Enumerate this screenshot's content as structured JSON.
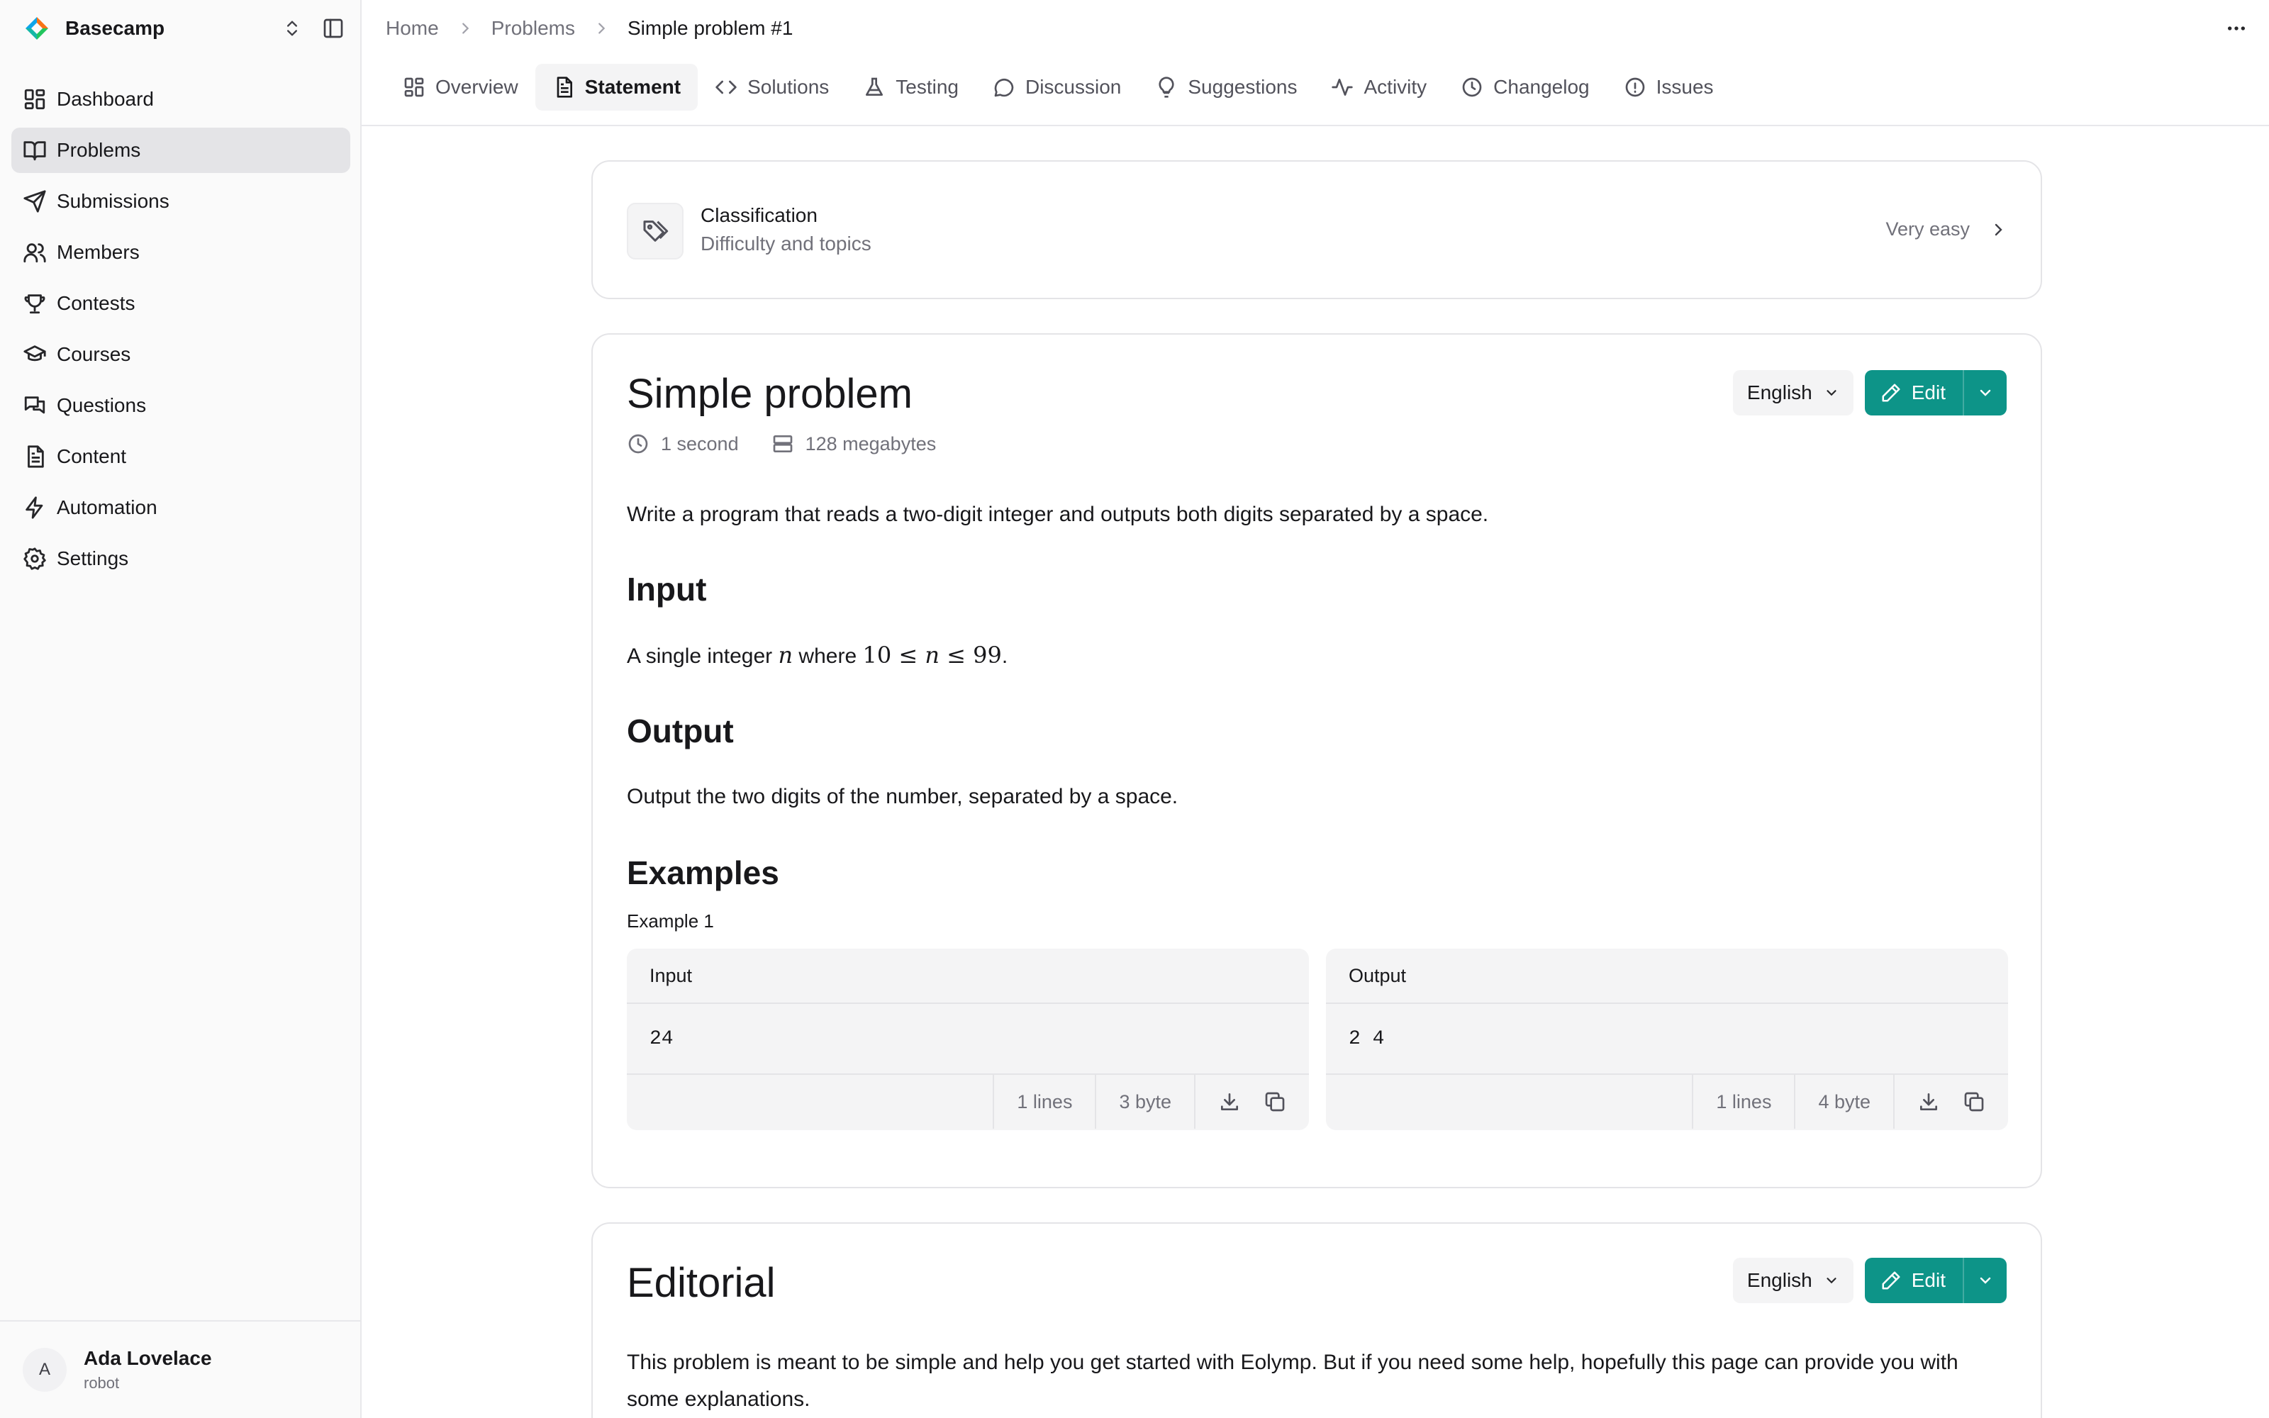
{
  "app": {
    "name": "Basecamp"
  },
  "sidebar": {
    "items": [
      {
        "label": "Dashboard",
        "icon": "dashboard-icon"
      },
      {
        "label": "Problems",
        "icon": "book-icon",
        "active": true
      },
      {
        "label": "Submissions",
        "icon": "send-icon"
      },
      {
        "label": "Members",
        "icon": "users-icon"
      },
      {
        "label": "Contests",
        "icon": "trophy-icon"
      },
      {
        "label": "Courses",
        "icon": "graduation-cap-icon"
      },
      {
        "label": "Questions",
        "icon": "messages-icon"
      },
      {
        "label": "Content",
        "icon": "file-text-icon"
      },
      {
        "label": "Automation",
        "icon": "zap-icon"
      },
      {
        "label": "Settings",
        "icon": "gear-icon"
      }
    ]
  },
  "user": {
    "initial": "A",
    "name": "Ada Lovelace",
    "role": "robot"
  },
  "breadcrumb": {
    "items": [
      "Home",
      "Problems",
      "Simple problem #1"
    ]
  },
  "tabs": [
    {
      "label": "Overview",
      "icon": "layout-grid-icon"
    },
    {
      "label": "Statement",
      "icon": "file-text-icon",
      "active": true
    },
    {
      "label": "Solutions",
      "icon": "code-icon"
    },
    {
      "label": "Testing",
      "icon": "flask-icon"
    },
    {
      "label": "Discussion",
      "icon": "chat-bubble-icon"
    },
    {
      "label": "Suggestions",
      "icon": "lightbulb-icon"
    },
    {
      "label": "Activity",
      "icon": "activity-icon"
    },
    {
      "label": "Changelog",
      "icon": "clock-icon"
    },
    {
      "label": "Issues",
      "icon": "alert-circle-icon"
    }
  ],
  "classification": {
    "title": "Classification",
    "subtitle": "Difficulty and topics",
    "difficulty": "Very easy"
  },
  "problem": {
    "title": "Simple problem",
    "language": "English",
    "edit_label": "Edit",
    "time_limit": "1 second",
    "memory_limit": "128 megabytes",
    "description": "Write a program that reads a two-digit integer and outputs both digits separated by a space.",
    "input_heading": "Input",
    "input_text_a": "A single integer ",
    "input_var": "n",
    "input_text_b": " where ",
    "input_math_lo": "10 ≤ ",
    "input_math_hi": " ≤ 99",
    "input_text_end": ".",
    "output_heading": "Output",
    "output_text": "Output the two digits of the number, separated by a space.",
    "examples_heading": "Examples",
    "example_label": "Example 1",
    "example": {
      "input": {
        "label": "Input",
        "content": "24",
        "lines": "1 lines",
        "size": "3 byte"
      },
      "output": {
        "label": "Output",
        "content": "2 4",
        "lines": "1 lines",
        "size": "4 byte"
      }
    }
  },
  "editorial": {
    "title": "Editorial",
    "language": "English",
    "edit_label": "Edit",
    "text": "This problem is meant to be simple and help you get started with Eolymp. But if you need some help, hopefully this page can provide you with some explanations."
  },
  "colors": {
    "accent": "#0d9488",
    "sidebar_bg": "#fafafa",
    "active_item": "#e4e4e7"
  }
}
